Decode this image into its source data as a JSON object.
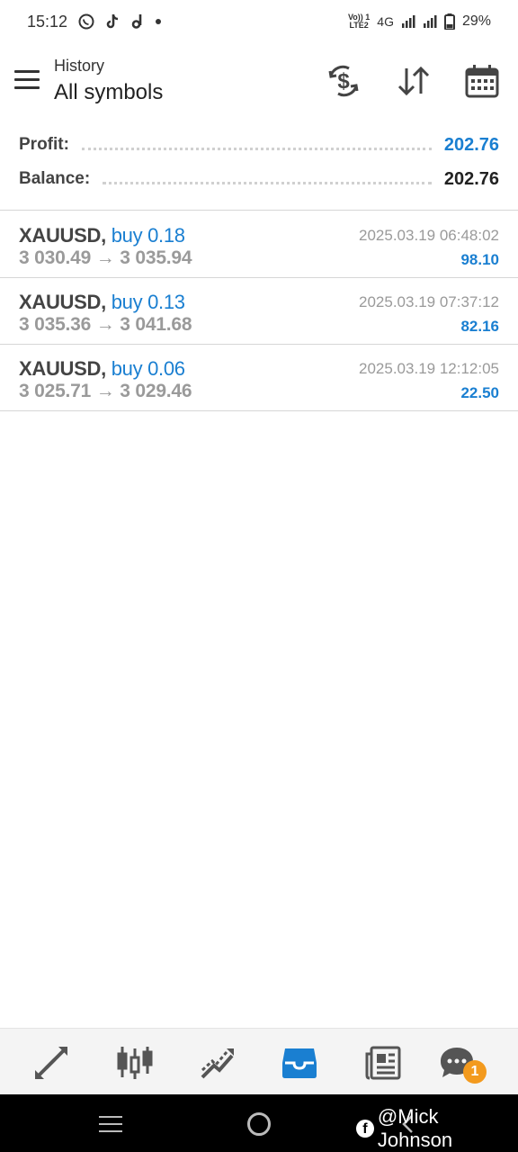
{
  "status_bar": {
    "time": "15:12",
    "volte_line1": "Vo)) 1",
    "volte_line2": "LTE2",
    "network": "4G",
    "battery": "29%"
  },
  "header": {
    "subtitle": "History",
    "title": "All symbols"
  },
  "summary": {
    "profit_label": "Profit:",
    "profit_value": "202.76",
    "balance_label": "Balance:",
    "balance_value": "202.76"
  },
  "trades": [
    {
      "symbol": "XAUUSD,",
      "side": "buy 0.18",
      "open": "3 030.49",
      "arrow": "→",
      "close": "3 035.94",
      "datetime": "2025.03.19 06:48:02",
      "profit": "98.10"
    },
    {
      "symbol": "XAUUSD,",
      "side": "buy 0.13",
      "open": "3 035.36",
      "arrow": "→",
      "close": "3 041.68",
      "datetime": "2025.03.19 07:37:12",
      "profit": "82.16"
    },
    {
      "symbol": "XAUUSD,",
      "side": "buy 0.06",
      "open": "3 025.71",
      "arrow": "→",
      "close": "3 029.46",
      "datetime": "2025.03.19 12:12:05",
      "profit": "22.50"
    }
  ],
  "tabbar": {
    "active_tab": "history",
    "chat_badge": "1",
    "accent": "#1a7fd1",
    "badge_color": "#f39a1e"
  },
  "watermark": {
    "text": "@Mick Johnson"
  }
}
